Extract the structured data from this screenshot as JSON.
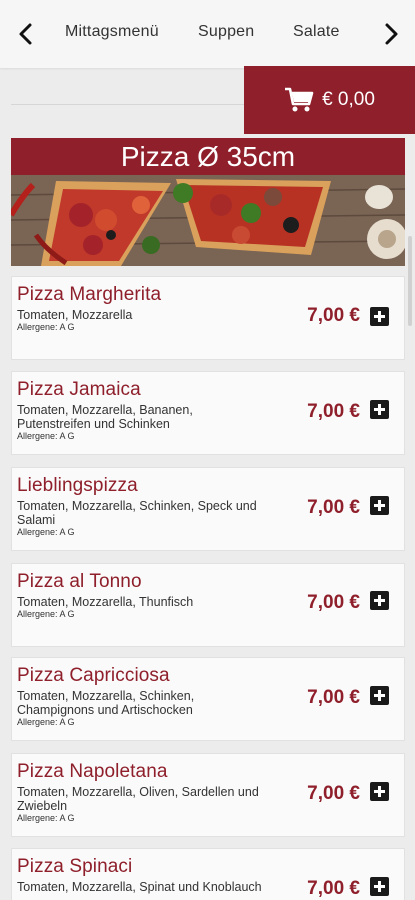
{
  "nav": {
    "items": [
      "Mittagsmenü",
      "Suppen",
      "Salate"
    ]
  },
  "cart": {
    "label": "€ 0,00"
  },
  "category": {
    "title": "Pizza Ø 35cm"
  },
  "products": [
    {
      "name": "Pizza Margherita",
      "desc": "Tomaten, Mozzarella",
      "allergens": "Allergene: A G",
      "price": "7,00 €"
    },
    {
      "name": "Pizza Jamaica",
      "desc": "Tomaten, Mozzarella, Bananen, Putenstreifen und Schinken",
      "allergens": "Allergene: A G",
      "price": "7,00 €"
    },
    {
      "name": "Lieblingspizza",
      "desc": "Tomaten, Mozzarella, Schinken, Speck und Salami",
      "allergens": "Allergene: A G",
      "price": "7,00 €"
    },
    {
      "name": "Pizza al Tonno",
      "desc": "Tomaten, Mozzarella, Thunfisch",
      "allergens": "Allergene: A G",
      "price": "7,00 €"
    },
    {
      "name": "Pizza Capricciosa",
      "desc": "Tomaten, Mozzarella, Schinken, Champignons und Artischocken",
      "allergens": "Allergene: A G",
      "price": "7,00 €"
    },
    {
      "name": "Pizza Napoletana",
      "desc": "Tomaten, Mozzarella, Oliven, Sardellen und Zwiebeln",
      "allergens": "Allergene: A G",
      "price": "7,00 €"
    },
    {
      "name": "Pizza Spinaci",
      "desc": "Tomaten, Mozzarella, Spinat und Knoblauch",
      "allergens": "",
      "price": "7,00 €"
    }
  ]
}
